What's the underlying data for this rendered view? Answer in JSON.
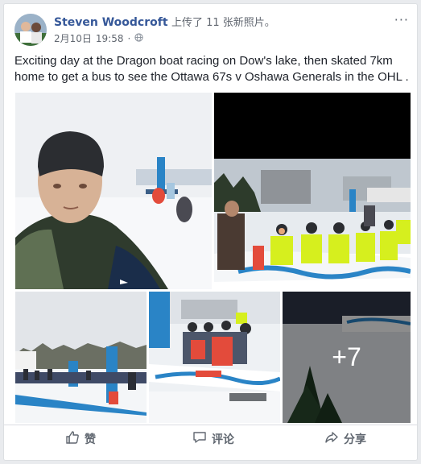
{
  "post": {
    "author_name": "Steven Woodcroft",
    "action_text": "上传了 11 张新照片。",
    "date": "2月10日",
    "time": "19:58",
    "more_label": "···",
    "text": "Exciting day at the Dragon boat racing on Dow's lake, then skated 7km home to get a bus to see the Ottawa 67s v Oshawa Generals in the OHL .",
    "privacy_icon": "globe-icon"
  },
  "photos": {
    "more_count": "+7"
  },
  "actions": {
    "like_label": "赞",
    "comment_label": "评论",
    "share_label": "分享"
  },
  "colors": {
    "link": "#365899",
    "muted": "#606770",
    "card_border": "#dddfe2",
    "boat_blue": "#2a84c6",
    "vest_yellow": "#d6ef1e"
  }
}
